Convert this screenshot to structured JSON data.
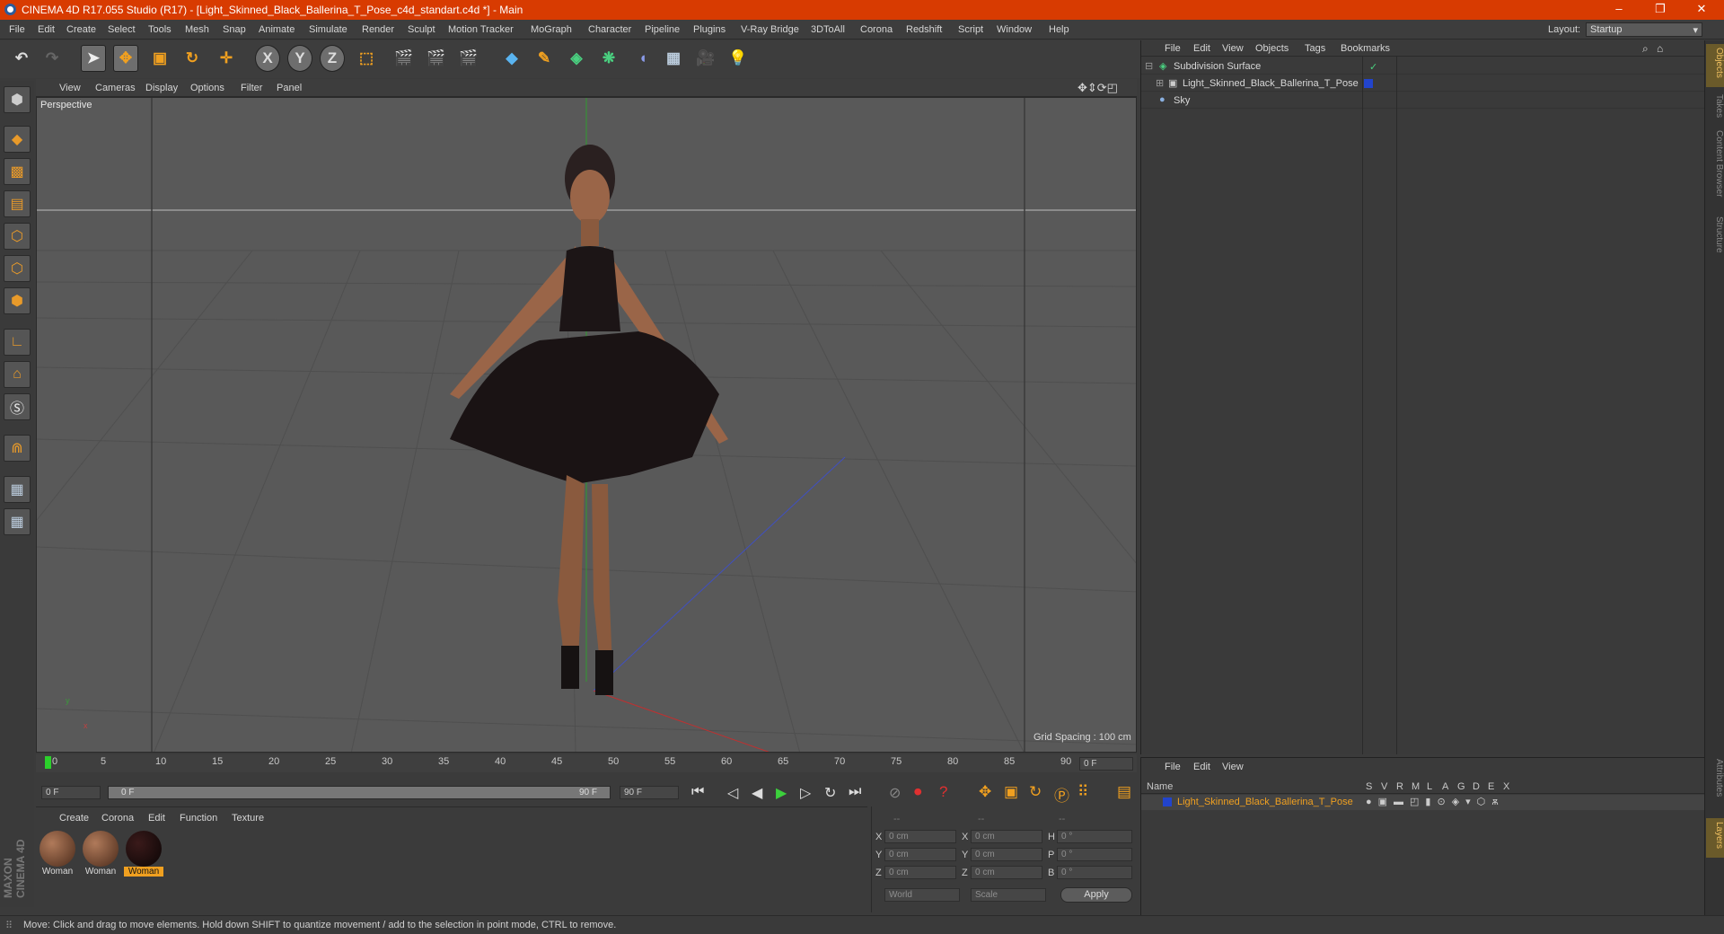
{
  "window": {
    "title": "CINEMA 4D R17.055 Studio (R17) - [Light_Skinned_Black_Ballerina_T_Pose_c4d_standart.c4d *] - Main",
    "minimize": "–",
    "restore": "❐",
    "close": "✕"
  },
  "menubar": {
    "items": [
      "File",
      "Edit",
      "Create",
      "Select",
      "Tools",
      "Mesh",
      "Snap",
      "Animate",
      "Simulate",
      "Render",
      "Sculpt",
      "Motion Tracker",
      "MoGraph",
      "Character",
      "Pipeline",
      "Plugins",
      "V-Ray Bridge",
      "3DToAll",
      "Corona",
      "Redshift",
      "Script",
      "Window",
      "Help"
    ],
    "layout_label": "Layout:",
    "layout_value": "Startup"
  },
  "toolbar": {
    "axis_x": "X",
    "axis_y": "Y",
    "axis_z": "Z"
  },
  "viewport": {
    "menu": [
      "View",
      "Cameras",
      "Display",
      "Options",
      "Filter",
      "Panel"
    ],
    "label": "Perspective",
    "grid_spacing": "Grid Spacing : 100 cm",
    "axis_y": "y",
    "axis_x": "x"
  },
  "timeline": {
    "ticks": [
      "0",
      "5",
      "10",
      "15",
      "20",
      "25",
      "30",
      "35",
      "40",
      "45",
      "50",
      "55",
      "60",
      "65",
      "70",
      "75",
      "80",
      "85",
      "90"
    ],
    "current_frame": "0 F"
  },
  "transport": {
    "start_field": "0 F",
    "range_start": "0 F",
    "range_end": "90 F",
    "end_field": "90 F"
  },
  "materials": {
    "menu": [
      "Create",
      "Corona",
      "Edit",
      "Function",
      "Texture"
    ],
    "items": [
      {
        "name": "Woman",
        "selected": false
      },
      {
        "name": "Woman",
        "selected": false
      },
      {
        "name": "Woman",
        "selected": true
      }
    ]
  },
  "coords": {
    "header": [
      "--",
      "--",
      "--"
    ],
    "rows": [
      {
        "l1": "X",
        "v1": "0 cm",
        "l2": "X",
        "v2": "0 cm",
        "l3": "H",
        "v3": "0 °"
      },
      {
        "l1": "Y",
        "v1": "0 cm",
        "l2": "Y",
        "v2": "0 cm",
        "l3": "P",
        "v3": "0 °"
      },
      {
        "l1": "Z",
        "v1": "0 cm",
        "l2": "Z",
        "v2": "0 cm",
        "l3": "B",
        "v3": "0 °"
      }
    ],
    "mode1": "World",
    "mode2": "Scale",
    "apply": "Apply"
  },
  "objects": {
    "menu": [
      "File",
      "Edit",
      "View",
      "Objects",
      "Tags",
      "Bookmarks"
    ],
    "items": [
      {
        "name": "Subdivision Surface",
        "indent": 0
      },
      {
        "name": "Light_Skinned_Black_Ballerina_T_Pose",
        "indent": 1
      },
      {
        "name": "Sky",
        "indent": 0
      }
    ]
  },
  "layers": {
    "menu": [
      "File",
      "Edit",
      "View"
    ],
    "col_name": "Name",
    "cols": [
      "S",
      "V",
      "R",
      "M",
      "L",
      "A",
      "G",
      "D",
      "E",
      "X"
    ],
    "row": "Light_Skinned_Black_Ballerina_T_Pose"
  },
  "right_tabs": [
    "Objects",
    "Takes",
    "Content Browser",
    "Structure"
  ],
  "right_tabs_bottom": [
    "Attributes",
    "Layers"
  ],
  "brand": "MAXON CINEMA 4D",
  "status": "Move: Click and drag to move elements. Hold down SHIFT to quantize movement / add to the selection in point mode, CTRL to remove.",
  "colors": {
    "titlebar": "#d83b01",
    "selected": "#f0a020"
  }
}
